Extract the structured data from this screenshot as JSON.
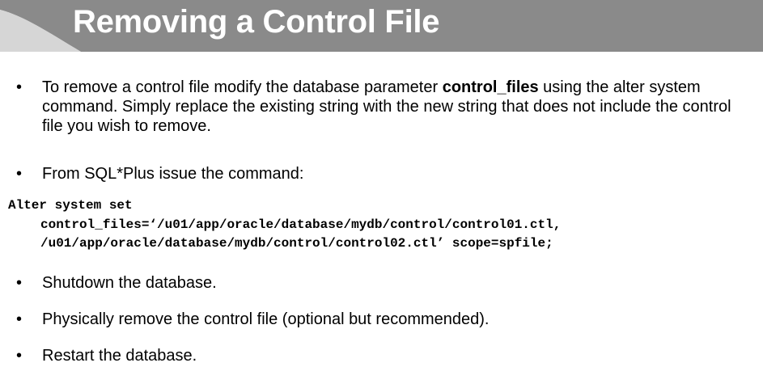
{
  "title": "Removing a Control File",
  "bullets": {
    "b1_before": "To remove a control file modify the database parameter ",
    "b1_bold": "control_files",
    "b1_after": " using the alter system command. Simply replace the existing string with the new string that does not include the control file you wish to remove.",
    "b2": "From SQL*Plus issue the command:",
    "b3": "Shutdown the database.",
    "b4": "Physically remove the control file (optional but recommended).",
    "b5": "Restart the database."
  },
  "code": {
    "line1": "Alter system set",
    "line2": "control_files=‘/u01/app/oracle/database/mydb/control/control01.ctl,",
    "line3": "/u01/app/oracle/database/mydb/control/control02.ctl’ scope=spfile;"
  },
  "colors": {
    "title_bar": "#8a8a8a",
    "title_text": "#ffffff"
  }
}
